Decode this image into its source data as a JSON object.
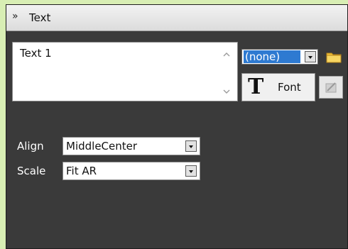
{
  "header": {
    "title": "Text",
    "collapse_icon": "double-chevron-down-icon"
  },
  "text_input": {
    "value": "Text 1"
  },
  "font_source": {
    "selected": "(none)",
    "folder_icon": "folder-icon"
  },
  "font_button": {
    "glyph": "T",
    "label": "Font"
  },
  "edit_button": {
    "icon": "edit-icon"
  },
  "align": {
    "label": "Align",
    "value": "MiddleCenter"
  },
  "scale": {
    "label": "Scale",
    "value": "Fit AR"
  },
  "colors": {
    "panel_bg": "#3a3a3a",
    "selection": "#2e7ad1",
    "window_bg": "#d8eeb4"
  }
}
